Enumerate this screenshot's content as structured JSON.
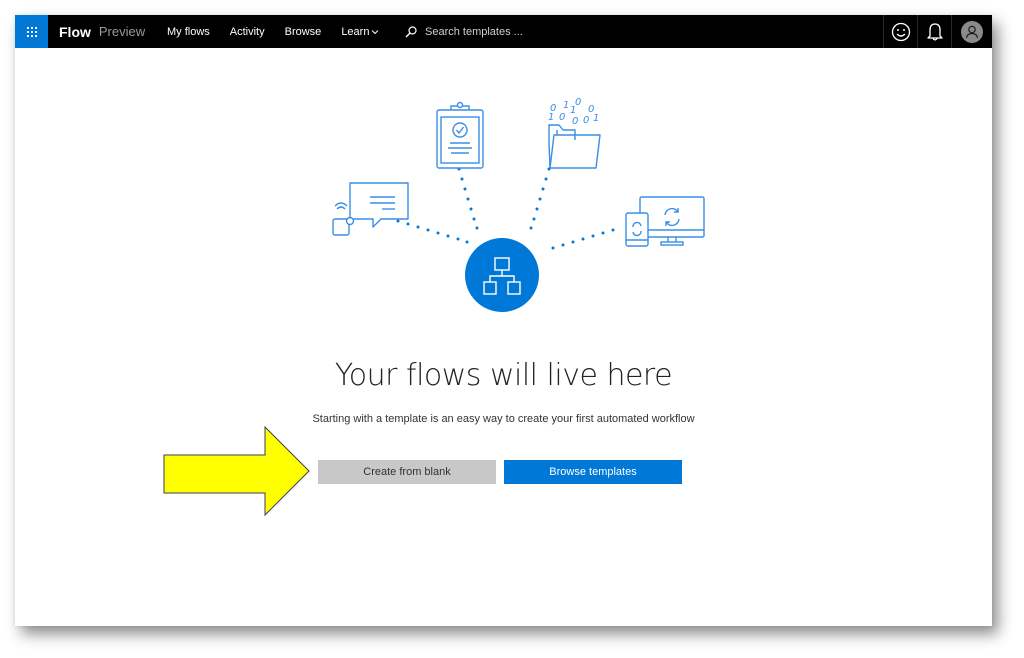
{
  "header": {
    "app_launcher_icon": "waffle-grid-icon",
    "brand_name": "Flow",
    "brand_tag": "Preview",
    "nav": [
      {
        "label": "My flows"
      },
      {
        "label": "Activity"
      },
      {
        "label": "Browse"
      },
      {
        "label": "Learn",
        "has_dropdown": true
      }
    ],
    "search": {
      "icon": "search-icon",
      "placeholder": "Search templates ..."
    },
    "right_icons": [
      "smiley-feedback-icon",
      "bell-notifications-icon",
      "user-avatar-icon"
    ]
  },
  "illustration": {
    "center_icon": "flow-hierarchy-icon",
    "satellites": [
      "chat-device-icon",
      "clipboard-check-icon",
      "folder-binary-data-icon",
      "devices-sync-icon"
    ],
    "binary_digits": [
      "0",
      "1",
      "0",
      "0",
      "1",
      "0",
      "0",
      "0",
      "1",
      "1"
    ],
    "colors": {
      "accent": "#0078d7",
      "line": "#3a8ee6"
    }
  },
  "main": {
    "headline": "Your flows will live here",
    "subtext": "Starting with a template is an easy way to create your first automated workflow",
    "create_blank_label": "Create from blank",
    "browse_templates_label": "Browse templates"
  },
  "annotation": {
    "type": "arrow",
    "color": "#ffff00",
    "points_to": "Create from blank"
  }
}
